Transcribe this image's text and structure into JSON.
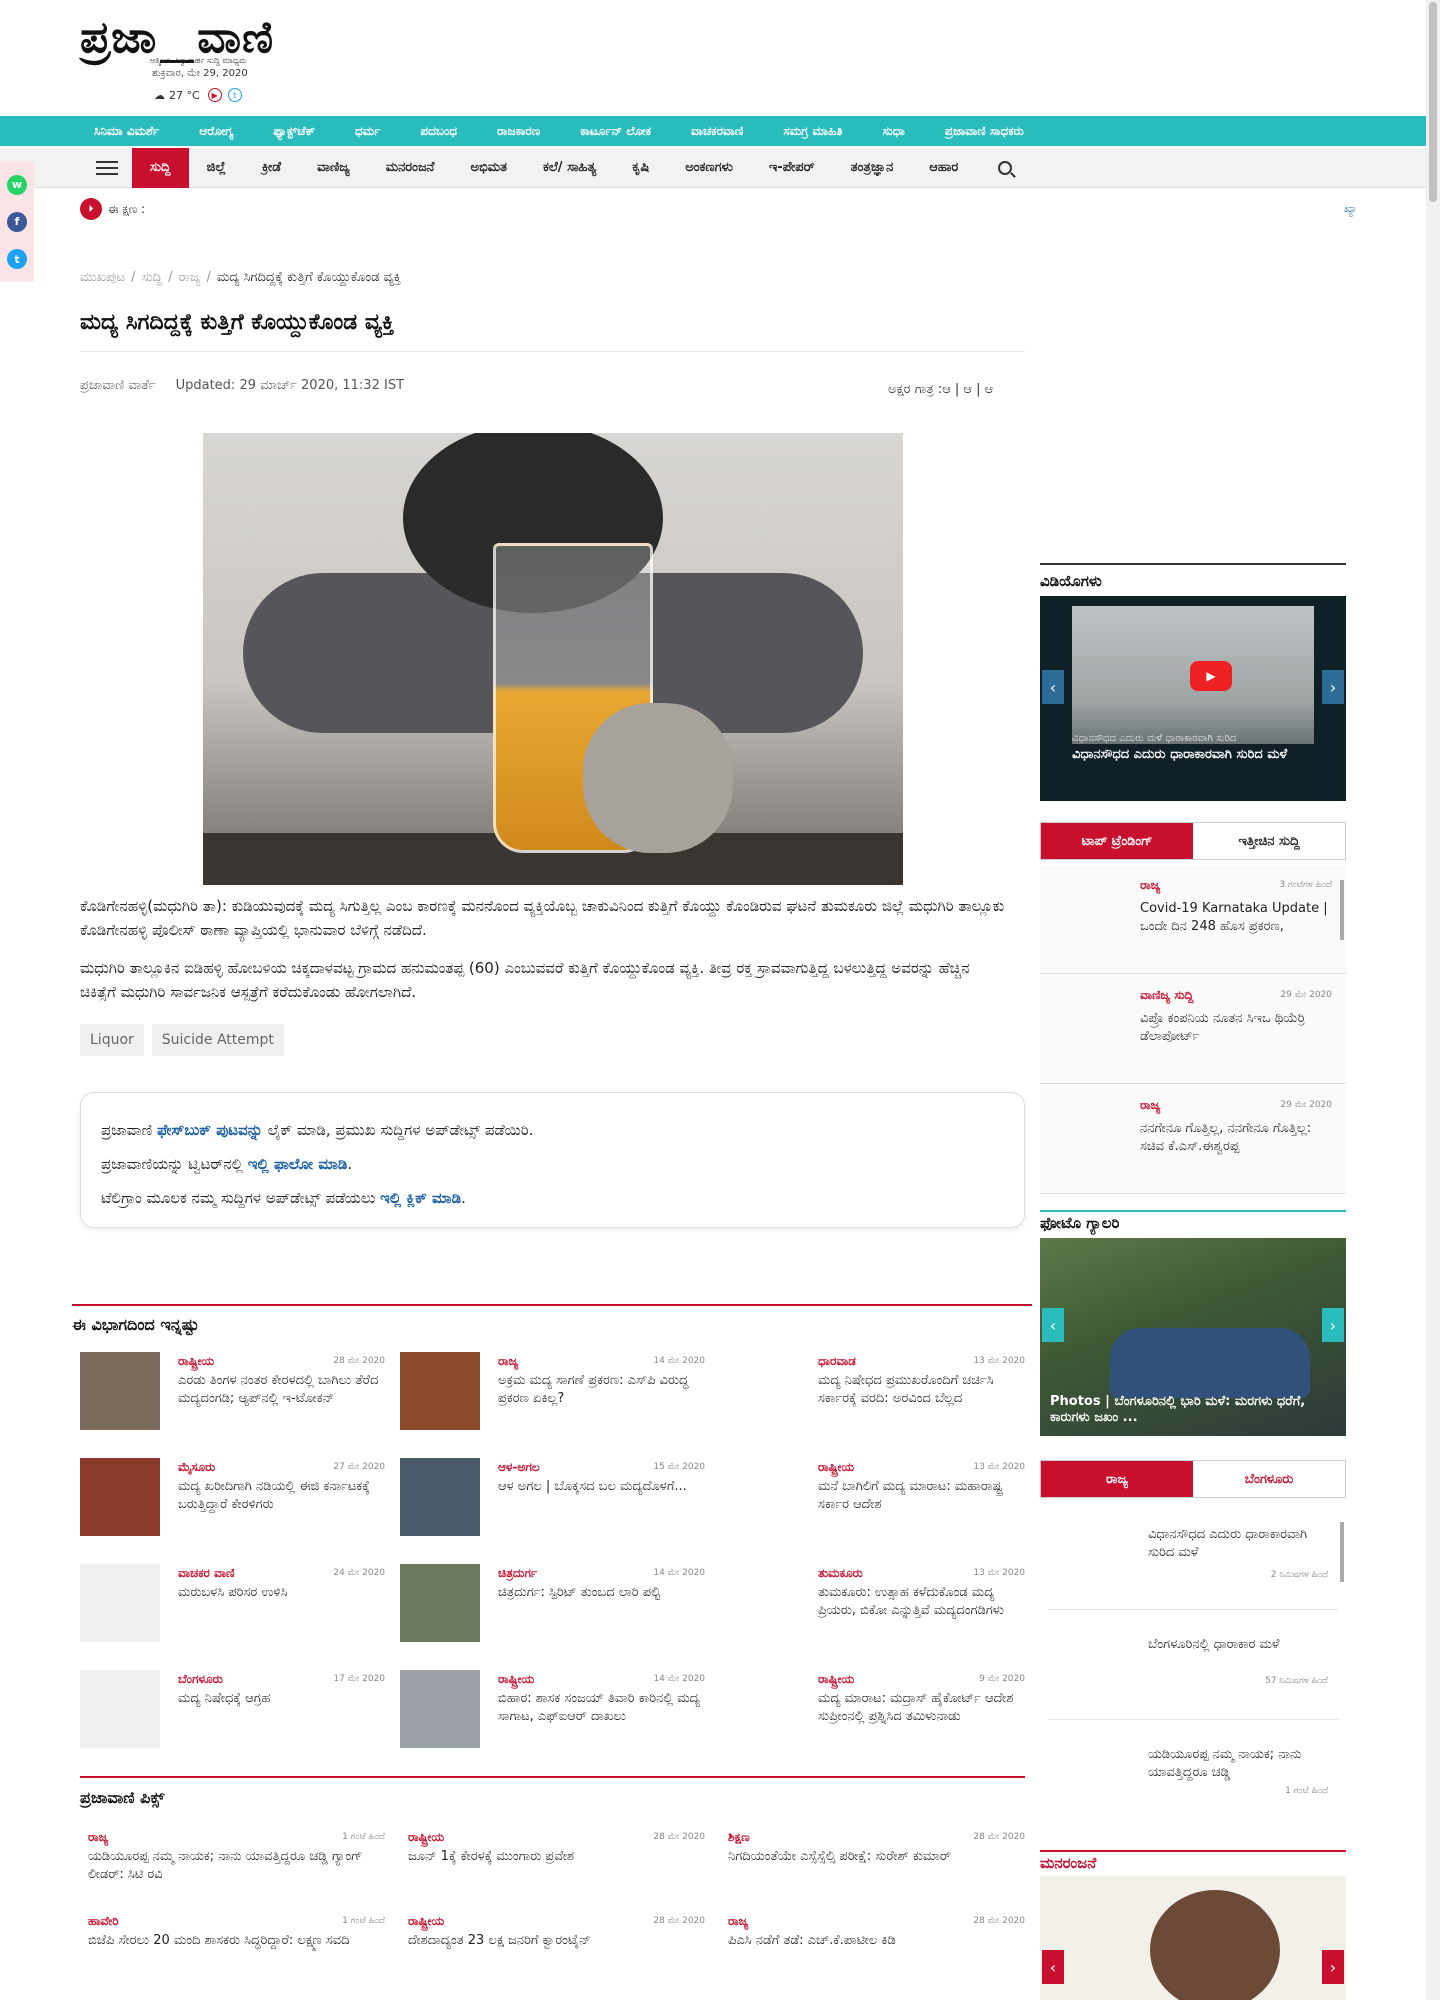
{
  "brand": {
    "logo_left": "ಪ್ರಜಾ",
    "logo_right": "ವಾಣಿ",
    "tagline": "ಆತ್ಮೀಯ ವಿಶ್ವಾಸಾರ್ಹ ಸುದ್ದಿ ಮಾಧ್ಯಮ",
    "date": "ಶುಕ್ರವಾರ, ಮೇ 29, 2020",
    "temperature": "27 °C"
  },
  "nav_primary": [
    "ಸಿನಿಮಾ ವಿಮರ್ಶೆ",
    "ಆರೋಗ್ಯ",
    "ಫ್ಯಾಕ್ಟ್‌ಚೆಕ್",
    "ಧರ್ಮ",
    "ಪದಬಂಧ",
    "ರಾಜಕಾರಣ",
    "ಕಾರ್ಟೂನ್ ಲೋಕ",
    "ವಾಚಕರವಾಣಿ",
    "ಸಮಗ್ರ ಮಾಹಿತಿ",
    "ಸುಧಾ",
    "ಪ್ರಜಾವಾಣಿ ಸಾಧಕರು"
  ],
  "nav_secondary": [
    "ಸುದ್ದಿ",
    "ಜಿಲ್ಲೆ",
    "ಕ್ರೀಡೆ",
    "ವಾಣಿಜ್ಯ",
    "ಮನರಂಜನೆ",
    "ಅಭಿಮತ",
    "ಕಲೆ/ ಸಾಹಿತ್ಯ",
    "ಕೃಷಿ",
    "ಅಂಕಣಗಳು",
    "ಇ-ಪೇಪರ್",
    "ತಂತ್ರಜ್ಞಾನ",
    "ಆಹಾರ"
  ],
  "ticker": {
    "label": "ಈ ಕ್ಷಣ :",
    "right": "ಖ್ಯಾ"
  },
  "breadcrumb": [
    "ಮುಖಪುಟ",
    "ಸುದ್ದಿ",
    "ರಾಜ್ಯ",
    "ಮದ್ಯ ಸಿಗದಿದ್ದಕ್ಕೆ ಕುತ್ತಿಗೆ ಕೊಯ್ದುಕೊಂಡ ವ್ಯಕ್ತಿ"
  ],
  "article": {
    "title": "ಮದ್ಯ ಸಿಗದಿದ್ದಕ್ಕೆ ಕುತ್ತಿಗೆ ಕೊಯ್ದುಕೊಂಡ ವ್ಯಕ್ತಿ",
    "author": "ಪ್ರಜಾವಾಣಿ ವಾರ್ತೆ",
    "updated_label": "Updated:",
    "updated": "29 ಮಾರ್ಚ್ 2020, 11:32 IST",
    "font_size_label": "ಅಕ್ಷರ ಗಾತ್ರ :ಆ | ಆ | ಆ",
    "para1": "ಕೊಡಿಗೇನಹಳ್ಳಿ(ಮಧುಗಿರಿ ತಾ): ಕುಡಿಯುವುದಕ್ಕೆ ಮದ್ಯ ಸಿಗುತ್ತಿಲ್ಲ ಎಂಬ ಕಾರಣಕ್ಕೆ ಮನನೊಂದ ವ್ಯಕ್ತಿಯೊಬ್ಬ ಚಾಕುವಿನಿಂದ ಕುತ್ತಿಗೆ ಕೊಯ್ದು ಕೊಂಡಿರುವ ಘಟನೆ ತುಮಕೂರು ಜಿಲ್ಲೆ ಮಧುಗಿರಿ ತಾಲ್ಲೂಕು ಕೊಡಿಗೇನಹಳ್ಳಿ ಪೊಲೀಸ್ ಠಾಣಾ ವ್ಯಾಪ್ತಿಯಲ್ಲಿ ಭಾನುವಾರ ಬೆಳಿಗ್ಗೆ ನಡೆದಿದೆ.",
    "para2": "ಮಧುಗಿರಿ ತಾಲ್ಲೂಕಿನ ಐಡಿಹಳ್ಳಿ ಹೋಬಳಿಯ ಚಿಕ್ಕದಾಳವಟ್ಟ ಗ್ರಾಮದ ಹನುಮಂತಪ್ಪ (60) ಎಂಬುವವರೆ ಕುತ್ತಿಗೆ ಕೊಯ್ದುಕೊಂಡ ವ್ಯಕ್ತಿ. ತೀವ್ರ ರಕ್ತ ಸ್ರಾವವಾಗುತ್ತಿದ್ದ ಬಳಲುತ್ತಿದ್ದ ಅವರನ್ನು ಹೆಚ್ಚಿನ ಚಿಕಿತ್ಸೆಗೆ ಮಧುಗಿರಿ ಸಾರ್ವಜನಿಕ ಆಸ್ಪತ್ರೆಗೆ ಕರೆದುಕೊಂಡು ಹೋಗಲಾಗಿದೆ.",
    "tags": [
      "Liquor",
      "Suicide Attempt"
    ]
  },
  "follow": {
    "l1_a": "ಪ್ರಜಾವಾಣಿ ",
    "l1_link": "ಫೇಸ್‌ಬುಕ್ ಪುಟವನ್ನು",
    "l1_b": " ಲೈಕ್ ಮಾಡಿ, ಪ್ರಮುಖ ಸುದ್ದಿಗಳ ಅಪ್‌ಡೇಟ್ಸ್ ಪಡೆಯಿರಿ.",
    "l2_a": "ಪ್ರಜಾವಾಣಿಯನ್ನು ಟ್ವಿಟರ್‌ನಲ್ಲಿ ",
    "l2_link": "ಇಲ್ಲಿ ಫಾಲೋ ಮಾಡಿ",
    "l2_b": ".",
    "l3_a": "ಟೆಲಿಗ್ರಾಂ ಮೂಲಕ ನಮ್ಮ ಸುದ್ದಿಗಳ ಅಪ್‌ಡೇಟ್ಸ್ ಪಡೆಯಲು ",
    "l3_link": "ಇಲ್ಲಿ ಕ್ಲಿಕ್ ಮಾಡಿ",
    "l3_b": "."
  },
  "more_section": {
    "title": "ಈ ವಿಭಾಗದಿಂದ ಇನ್ನಷ್ಟು",
    "items": [
      {
        "cat": "ರಾಷ್ಟ್ರೀಯ",
        "date": "28 ಮೇ 2020",
        "headline": "ಎರಡು ತಿಂಗಳ ನಂತರ ಕೇರಳದಲ್ಲಿ ಬಾಗಿಲು ತೆರೆದ ಮದ್ಯದಂಗಡಿ; ಆ್ಯಪ್‌ನಲ್ಲಿ ಇ-ಟೋಕನ್",
        "thumb": "#7a6a5a"
      },
      {
        "cat": "ರಾಜ್ಯ",
        "date": "14 ಮೇ 2020",
        "headline": "ಅಕ್ರಮ ಮದ್ಯ ಸಾಗಣೆ ಪ್ರಕರಣ: ಎಸ್‌ಪಿ ವಿರುದ್ಧ ಪ್ರಕರಣ ಏಕಿಲ್ಲ?",
        "thumb": "#8a4a2a"
      },
      {
        "cat": "ಧಾರವಾಡ",
        "date": "13 ಮೇ 2020",
        "headline": "ಮದ್ಯ ನಿಷೇಧದ ಪ್ರಮುಖರೊಂದಿಗೆ ಚರ್ಚಿಸಿ ಸರ್ಕಾರಕ್ಕೆ ವರದಿ: ಅರವಿಂದ ಬೆಲ್ಲದ",
        "thumb": ""
      },
      {
        "cat": "ಮೈಸೂರು",
        "date": "27 ಮೇ 2020",
        "headline": "ಮದ್ಯ ಖರೀದಿಗಾಗಿ ನಡಿಯಲ್ಲಿ ಈಜಿ ಕರ್ನಾಟಕಕ್ಕೆ ಬರುತ್ತಿದ್ದಾರೆ ಕೇರಳಿಗರು",
        "thumb": "#8a3a2a"
      },
      {
        "cat": "ಆಳ-ಅಗಲ",
        "date": "15 ಮೇ 2020",
        "headline": "ಆಳ ಅಗಲ | ಬೊಕ್ಕಸದ ಬಲ ಮದ್ಯದೊಳಗೆ...",
        "thumb": "#4a5a6a"
      },
      {
        "cat": "ರಾಷ್ಟ್ರೀಯ",
        "date": "13 ಮೇ 2020",
        "headline": "ಮನೆ ಬಾಗಿಲಿಗೆ ಮದ್ಯ ಮಾರಾಟ: ಮಹಾರಾಷ್ಟ್ರ ಸರ್ಕಾರ ಆದೇಶ",
        "thumb": ""
      },
      {
        "cat": "ವಾಚಕರ ವಾಣಿ",
        "date": "24 ಮೇ 2020",
        "headline": "ಮರುಬಳಸಿ ಪರಿಸರ ಉಳಿಸಿ",
        "thumb": "#f0f0f0"
      },
      {
        "cat": "ಚಿತ್ರದುರ್ಗ",
        "date": "14 ಮೇ 2020",
        "headline": "ಚಿತ್ರದುರ್ಗ: ಸ್ಪಿರಿಟ್ ತುಂಬದ ಲಾರಿ ಪಲ್ಟಿ",
        "thumb": "#6a7a5a"
      },
      {
        "cat": "ತುಮಕೂರು",
        "date": "13 ಮೇ 2020",
        "headline": "ತುಮಕೂರು: ಉತ್ಸಾಹ ಕಳೆದುಕೊಂಡ ಮದ್ಯ ಪ್ರಿಯರು, ಬಿಕೋ ಎನ್ನುತ್ತಿವೆ ಮದ್ಯದಂಗಡಿಗಳು",
        "thumb": ""
      },
      {
        "cat": "ಬೆಂಗಳೂರು",
        "date": "17 ಮೇ 2020",
        "headline": "ಮದ್ಯ ನಿಷೇಧಕ್ಕೆ ಆಗ್ರಹ",
        "thumb": "#f0f0f0"
      },
      {
        "cat": "ರಾಷ್ಟ್ರೀಯ",
        "date": "14 ಮೇ 2020",
        "headline": "ಬಿಹಾರ: ಶಾಸಕ ಸಂಜಯ್ ತಿವಾರಿ ಕಾರಿನಲ್ಲಿ ಮದ್ಯ ಸಾಗಾಟ, ಎಫ್‌ಐಆರ್ ದಾಖಲು",
        "thumb": "#9aa0a6"
      },
      {
        "cat": "ರಾಷ್ಟ್ರೀಯ",
        "date": "9 ಮೇ 2020",
        "headline": "ಮದ್ಯ ಮಾರಾಟ: ಮದ್ರಾಸ್ ಹೈಕೋರ್ಟ್ ಆದೇಶ ಸುಪ್ರೀಂನಲ್ಲಿ ಪ್ರಶ್ನಿಸಿದ ತಮಿಳುನಾಡು",
        "thumb": ""
      }
    ]
  },
  "picks": {
    "title": "ಪ್ರಜಾವಾಣಿ ಪಿಕ್ಸ್",
    "items": [
      {
        "cat": "ರಾಜ್ಯ",
        "date": "1 ಗಂಟೆ ಹಿಂದೆ",
        "headline": "ಯಡಿಯೂರಪ್ಪ ನಮ್ಮ ನಾಯಕ; ನಾನು ಯಾವತ್ತಿದ್ದರೂ ಚಡ್ಡಿ ಗ್ಯಾಂಗ್ ಲೀಡರ್: ಸಿಟಿ ರವಿ"
      },
      {
        "cat": "ರಾಷ್ಟ್ರೀಯ",
        "date": "28 ಮೇ 2020",
        "headline": "ಜೂನ್ 1ಕ್ಕೆ ಕೇರಳಕ್ಕೆ ಮುಂಗಾರು ಪ್ರವೇಶ"
      },
      {
        "cat": "ಶಿಕ್ಷಣ",
        "date": "28 ಮೇ 2020",
        "headline": "ನಿಗದಿಯಂತೆಯೇ ಎಸ್ಸೆಸ್ಸೆಲ್ಸಿ ಪರೀಕ್ಷೆ: ಸುರೇಶ್ ಕುಮಾರ್"
      },
      {
        "cat": "ಹಾವೇರಿ",
        "date": "1 ಗಂಟೆ ಹಿಂದೆ",
        "headline": "ಬಿಜೆಪಿ ಸೇರಲು 20 ಮಂದಿ ಶಾಸಕರು ಸಿದ್ಧರಿದ್ದಾರೆ: ಲಕ್ಷ್ಮಣ ಸವದಿ"
      },
      {
        "cat": "ರಾಷ್ಟ್ರೀಯ",
        "date": "28 ಮೇ 2020",
        "headline": "ದೇಶದಾದ್ಯಂತ 23 ಲಕ್ಷ ಜನರಿಗೆ ಕ್ವಾರಂಟೈನ್"
      },
      {
        "cat": "ರಾಜ್ಯ",
        "date": "28 ಮೇ 2020",
        "headline": "ಪಿಎಸಿ ನಡೆಗೆ ತಡೆ: ಎಚ್.ಕೆ.ಪಾಟೀಲ ಕಿಡಿ"
      }
    ]
  },
  "sidebar": {
    "videos_title": "ವಿಡಿಯೊಗಳು",
    "video_overlay": "ವಿಧಾನಸೌಧದ ಎದುರು ಮಳೆ ಧಾರಾಕಾರವಾಗಿ ಸುರಿದ",
    "video_caption": "ವಿಧಾನಸೌಧದ ಎದುರು ಧಾರಾಕಾರವಾಗಿ ಸುರಿದ ಮಳೆ",
    "tab_top": "ಟಾಪ್ ಟ್ರೆಂಡಿಂಗ್",
    "tab_recent": "ಇತ್ತೀಚಿನ ಸುದ್ದಿ",
    "trending": [
      {
        "cat": "ರಾಜ್ಯ",
        "date": "3 ಗಂಟೆಗಳ ಹಿಂದೆ",
        "headline": "Covid-19 Karnataka Update | ಒಂದೇ ದಿನ 248 ಹೊಸ ಪ್ರಕರಣ,"
      },
      {
        "cat": "ವಾಣಿಜ್ಯ ಸುದ್ದಿ",
        "date": "29 ಮೇ 2020",
        "headline": "ವಿಪ್ರೊ ಕಂಪನಿಯ ನೂತನ ಸಿಇಒ ಥಿಯೆರ್ರಿ ಡೆಲಾಪೋರ್ಟ್"
      },
      {
        "cat": "ರಾಜ್ಯ",
        "date": "29 ಮೇ 2020",
        "headline": "ನನಗೇನೂ ಗೊತ್ತಿಲ್ಲ, ನನಗೇನೂ ಗೊತ್ತಿಲ್ಲ: ಸಚಿವ ಕೆ.ಎಸ್.ಈಶ್ವರಪ್ಪ"
      }
    ],
    "photo_title": "ಫೋಟೊ ಗ್ಯಾಲರಿ",
    "photo_caption": "Photos | ಬೆಂಗಳೂರಿನಲ್ಲಿ ಭಾರಿ ಮಳೆ: ಮರಗಳು ಧರೆಗೆ, ಕಾರುಗಳು ಜಖಂ ...",
    "tab_state": "ರಾಜ್ಯ",
    "tab_blr": "ಬೆಂಗಳೂರು",
    "state_news": [
      {
        "headline": "ವಿಧಾನಸೌಧದ ಎದುರು ಧಾರಾಕಾರವಾಗಿ ಸುರಿದ ಮಳೆ",
        "date": "2 ನಿಮಿಷಗಳ ಹಿಂದೆ"
      },
      {
        "headline": "ಬೆಂಗಳೂರಿನಲ್ಲಿ ಧಾರಾಕಾರ ಮಳೆ",
        "date": "57 ನಿಮಿಷಗಳ ಹಿಂದೆ"
      },
      {
        "headline": "ಯಡಿಯೂರಪ್ಪ ನಮ್ಮ ನಾಯಕ; ನಾನು ಯಾವತ್ತಿದ್ದರೂ ಚಡ್ಡಿ",
        "date": "1 ಗಂಟೆ ಹಿಂದೆ"
      }
    ],
    "ent_title": "ಮನರಂಜನೆ"
  },
  "colors": {
    "brand_red": "#c8102e",
    "teal": "#2abcbd",
    "link_blue": "#1a5fa8"
  }
}
